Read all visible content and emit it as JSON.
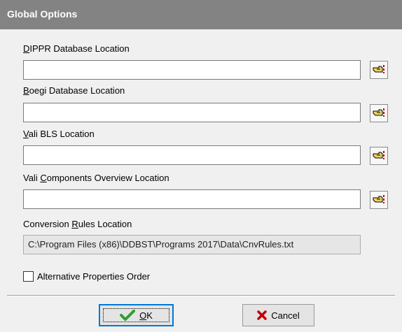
{
  "window": {
    "title": "Global Options"
  },
  "fields": [
    {
      "label_underline": "D",
      "label_rest": "IPPR Database Location",
      "value": ""
    },
    {
      "label_underline": "B",
      "label_rest": "oegi Database Location",
      "value": ""
    },
    {
      "label_underline": "V",
      "label_rest": "ali BLS Location",
      "value": ""
    },
    {
      "label_pre": "Vali ",
      "label_underline": "C",
      "label_rest": "omponents Overview Location",
      "value": ""
    }
  ],
  "conversion": {
    "label_pre": "Conversion ",
    "label_underline": "R",
    "label_rest": "ules Location",
    "value": "C:\\Program Files (x86)\\DDBST\\Programs 2017\\Data\\CnvRules.txt"
  },
  "checkbox": {
    "label": "Alternative Properties Order",
    "checked": false
  },
  "buttons": {
    "ok": {
      "underline": "O",
      "rest": "K",
      "icon": "checkmark-icon"
    },
    "cancel": {
      "label": "Cancel",
      "icon": "x-icon"
    }
  },
  "icons": {
    "browse": "pointing-hand-icon"
  },
  "colors": {
    "titlebar": "#838383",
    "ok_check": "#2e9e2e",
    "cancel_x": "#c00000",
    "browse_hand": "#d4a000"
  }
}
